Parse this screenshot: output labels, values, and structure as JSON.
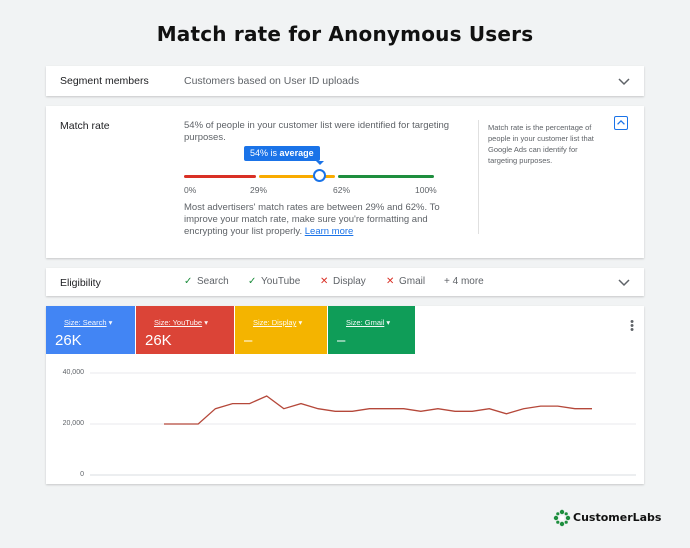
{
  "title": "Match rate for Anonymous Users",
  "segment": {
    "label": "Segment members",
    "value": "Customers based on User ID uploads"
  },
  "match_rate": {
    "label": "Match rate",
    "description": "54% of people in your customer list were identified for targeting purposes.",
    "badge_value": "54%",
    "badge_suffix": "is",
    "badge_word": "average",
    "level": 54,
    "ticks": [
      "0%",
      "29%",
      "62%",
      "100%"
    ],
    "note": "Most advertisers' match rates are between 29% and 62%. To improve your match rate, make sure you're formatting and encrypting your list properly.",
    "learn_more": "Learn more",
    "help_text": "Match rate is the percentage of people in your customer list that Google Ads can identify for targeting purposes.",
    "colors": {
      "low": "#d93025",
      "mid": "#f9ab00",
      "high": "#1e8e3e",
      "accent": "#1a73e8"
    }
  },
  "eligibility": {
    "label": "Eligibility",
    "items": [
      {
        "label": "Search",
        "status": "eligible",
        "icon": "check-icon"
      },
      {
        "label": "YouTube",
        "status": "eligible",
        "icon": "check-icon"
      },
      {
        "label": "Display",
        "status": "ineligible",
        "icon": "cross-icon"
      },
      {
        "label": "Gmail",
        "status": "ineligible",
        "icon": "cross-icon"
      }
    ],
    "more": "+ 4 more"
  },
  "tiles": [
    {
      "label": "Size: Search",
      "value": "26K",
      "color": "#4285f4"
    },
    {
      "label": "Size: YouTube",
      "value": "26K",
      "color": "#db4437"
    },
    {
      "label": "Size: Display",
      "value": "–",
      "color": "#f4b400"
    },
    {
      "label": "Size: Gmail",
      "value": "–",
      "color": "#0f9d58"
    }
  ],
  "chart_data": {
    "type": "line",
    "y_ticks": [
      "40,000",
      "20,000",
      "0"
    ],
    "ylim": [
      0,
      40000
    ],
    "grid": true,
    "series": [
      {
        "color": "#b5483a",
        "values": [
          20000,
          20000,
          20000,
          26000,
          28000,
          28000,
          31000,
          26000,
          28000,
          26000,
          25000,
          25000,
          26000,
          26000,
          26000,
          25000,
          26000,
          25000,
          25000,
          26000,
          24000,
          26000,
          27000,
          27000,
          26000,
          26000
        ]
      }
    ]
  },
  "brand": {
    "name": "CustomerLabs"
  }
}
